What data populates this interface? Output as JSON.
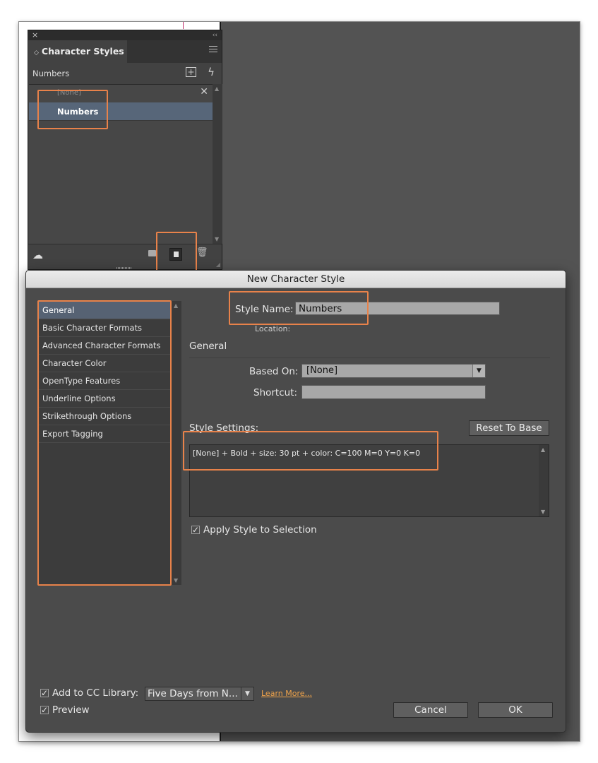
{
  "panel": {
    "close_glyph": "×",
    "collapse_glyph": "‹‹",
    "tab_title": "Character Styles",
    "current_style": "Numbers",
    "styles": [
      {
        "label": "[None]",
        "selected": false
      },
      {
        "label": "Numbers",
        "selected": true
      }
    ]
  },
  "dialog": {
    "title": "New Character Style",
    "categories": [
      "General",
      "Basic Character Formats",
      "Advanced Character Formats",
      "Character Color",
      "OpenType Features",
      "Underline Options",
      "Strikethrough Options",
      "Export Tagging"
    ],
    "selected_category": "General",
    "style_name_label": "Style Name:",
    "style_name_value": "Numbers",
    "location_label": "Location:",
    "section_title": "General",
    "based_on_label": "Based On:",
    "based_on_value": "[None]",
    "shortcut_label": "Shortcut:",
    "shortcut_value": "",
    "style_settings_label": "Style Settings:",
    "reset_button": "Reset To Base",
    "style_settings_text": "[None] + Bold + size: 30 pt + color: C=100 M=0 Y=0 K=0",
    "apply_checkbox_label": "Apply Style to Selection",
    "apply_checked": true,
    "cc_library_label": "Add to CC Library:",
    "cc_library_checked": true,
    "cc_library_value": "Five Days from N...",
    "learn_more": "Learn More...",
    "preview_label": "Preview",
    "preview_checked": true,
    "cancel_button": "Cancel",
    "ok_button": "OK"
  },
  "colors": {
    "highlight": "#e8824a",
    "selection": "#576679",
    "link": "#f0a34a"
  }
}
